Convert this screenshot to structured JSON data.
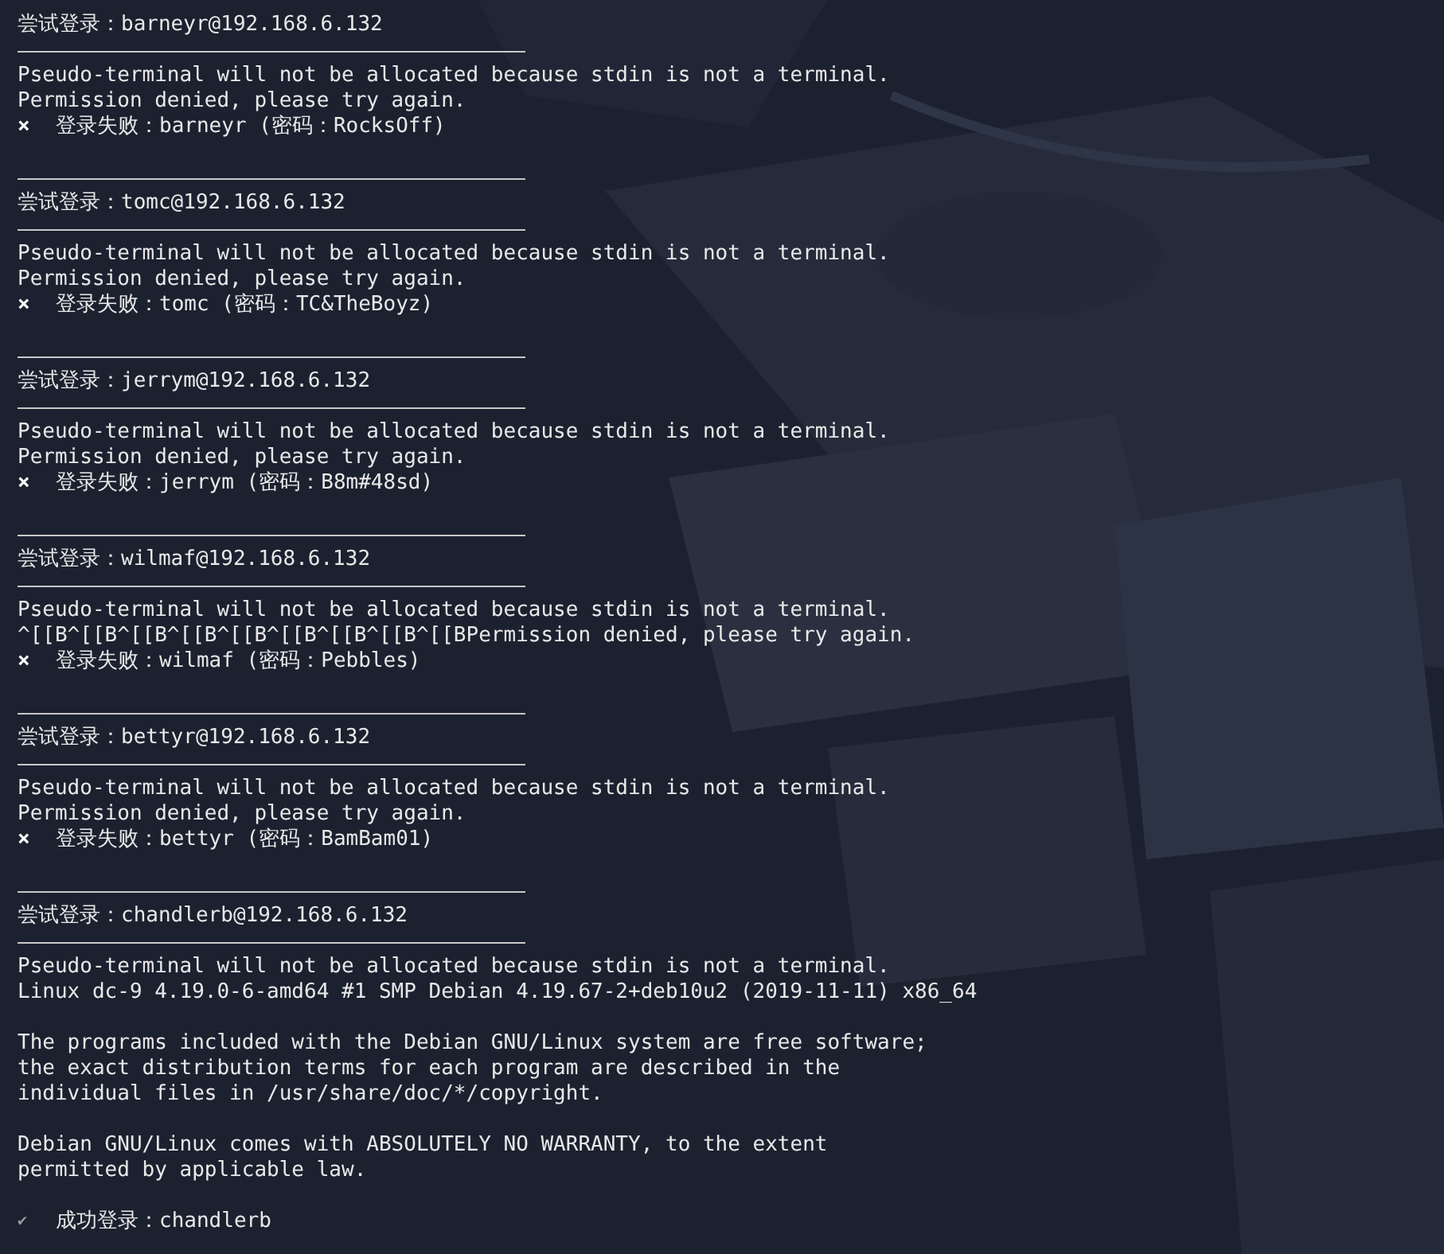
{
  "attempts": [
    {
      "header": "尝试登录：barneyr@192.168.6.132",
      "output": [
        [
          "Pseudo-terminal will not be allocated because stdin is not a terminal.",
          "Permission denied, please try again."
        ]
      ],
      "result": {
        "kind": "fail",
        "mark": "×",
        "text": "登录失败：barneyr (密码：RocksOff)"
      }
    },
    {
      "header": "尝试登录：tomc@192.168.6.132",
      "output": [
        [
          "Pseudo-terminal will not be allocated because stdin is not a terminal.",
          "Permission denied, please try again."
        ]
      ],
      "result": {
        "kind": "fail",
        "mark": "×",
        "text": "登录失败：tomc (密码：TC&TheBoyz)"
      }
    },
    {
      "header": "尝试登录：jerrym@192.168.6.132",
      "output": [
        [
          "Pseudo-terminal will not be allocated because stdin is not a terminal.",
          "Permission denied, please try again."
        ]
      ],
      "result": {
        "kind": "fail",
        "mark": "×",
        "text": "登录失败：jerrym (密码：B8m#48sd)"
      }
    },
    {
      "header": "尝试登录：wilmaf@192.168.6.132",
      "output": [
        [
          "Pseudo-terminal will not be allocated because stdin is not a terminal.",
          "^[[B^[[B^[[B^[[B^[[B^[[B^[[B^[[B^[[BPermission denied, please try again."
        ]
      ],
      "result": {
        "kind": "fail",
        "mark": "×",
        "text": "登录失败：wilmaf (密码：Pebbles)"
      }
    },
    {
      "header": "尝试登录：bettyr@192.168.6.132",
      "output": [
        [
          "Pseudo-terminal will not be allocated because stdin is not a terminal.",
          "Permission denied, please try again."
        ]
      ],
      "result": {
        "kind": "fail",
        "mark": "×",
        "text": "登录失败：bettyr (密码：BamBam01)"
      }
    },
    {
      "header": "尝试登录：chandlerb@192.168.6.132",
      "output": [
        [
          "Pseudo-terminal will not be allocated because stdin is not a terminal.",
          "Linux dc-9 4.19.0-6-amd64 #1 SMP Debian 4.19.67-2+deb10u2 (2019-11-11) x86_64"
        ],
        [
          "The programs included with the Debian GNU/Linux system are free software;",
          "the exact distribution terms for each program are described in the",
          "individual files in /usr/share/doc/*/copyright."
        ],
        [
          "Debian GNU/Linux comes with ABSOLUTELY NO WARRANTY, to the extent",
          "permitted by applicable law."
        ]
      ],
      "result": {
        "kind": "success",
        "mark": "✔",
        "text": "成功登录：chandlerb"
      }
    }
  ]
}
